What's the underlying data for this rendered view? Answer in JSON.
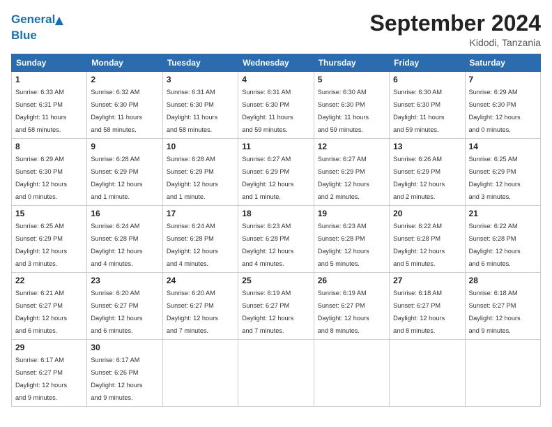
{
  "header": {
    "logo_line1": "General",
    "logo_line2": "Blue",
    "month": "September 2024",
    "location": "Kidodi, Tanzania"
  },
  "weekdays": [
    "Sunday",
    "Monday",
    "Tuesday",
    "Wednesday",
    "Thursday",
    "Friday",
    "Saturday"
  ],
  "days": [
    {
      "num": "1",
      "rise": "6:33 AM",
      "set": "6:31 PM",
      "hours": "11 hours",
      "mins": "58 minutes"
    },
    {
      "num": "2",
      "rise": "6:32 AM",
      "set": "6:30 PM",
      "hours": "11 hours",
      "mins": "58 minutes"
    },
    {
      "num": "3",
      "rise": "6:31 AM",
      "set": "6:30 PM",
      "hours": "11 hours",
      "mins": "58 minutes"
    },
    {
      "num": "4",
      "rise": "6:31 AM",
      "set": "6:30 PM",
      "hours": "11 hours",
      "mins": "59 minutes"
    },
    {
      "num": "5",
      "rise": "6:30 AM",
      "set": "6:30 PM",
      "hours": "11 hours",
      "mins": "59 minutes"
    },
    {
      "num": "6",
      "rise": "6:30 AM",
      "set": "6:30 PM",
      "hours": "11 hours",
      "mins": "59 minutes"
    },
    {
      "num": "7",
      "rise": "6:29 AM",
      "set": "6:30 PM",
      "hours": "12 hours",
      "mins": "0 minutes"
    },
    {
      "num": "8",
      "rise": "6:29 AM",
      "set": "6:30 PM",
      "hours": "12 hours",
      "mins": "0 minutes"
    },
    {
      "num": "9",
      "rise": "6:28 AM",
      "set": "6:29 PM",
      "hours": "12 hours",
      "mins": "1 minute"
    },
    {
      "num": "10",
      "rise": "6:28 AM",
      "set": "6:29 PM",
      "hours": "12 hours",
      "mins": "1 minute"
    },
    {
      "num": "11",
      "rise": "6:27 AM",
      "set": "6:29 PM",
      "hours": "12 hours",
      "mins": "1 minute"
    },
    {
      "num": "12",
      "rise": "6:27 AM",
      "set": "6:29 PM",
      "hours": "12 hours",
      "mins": "2 minutes"
    },
    {
      "num": "13",
      "rise": "6:26 AM",
      "set": "6:29 PM",
      "hours": "12 hours",
      "mins": "2 minutes"
    },
    {
      "num": "14",
      "rise": "6:25 AM",
      "set": "6:29 PM",
      "hours": "12 hours",
      "mins": "3 minutes"
    },
    {
      "num": "15",
      "rise": "6:25 AM",
      "set": "6:29 PM",
      "hours": "12 hours",
      "mins": "3 minutes"
    },
    {
      "num": "16",
      "rise": "6:24 AM",
      "set": "6:28 PM",
      "hours": "12 hours",
      "mins": "4 minutes"
    },
    {
      "num": "17",
      "rise": "6:24 AM",
      "set": "6:28 PM",
      "hours": "12 hours",
      "mins": "4 minutes"
    },
    {
      "num": "18",
      "rise": "6:23 AM",
      "set": "6:28 PM",
      "hours": "12 hours",
      "mins": "4 minutes"
    },
    {
      "num": "19",
      "rise": "6:23 AM",
      "set": "6:28 PM",
      "hours": "12 hours",
      "mins": "5 minutes"
    },
    {
      "num": "20",
      "rise": "6:22 AM",
      "set": "6:28 PM",
      "hours": "12 hours",
      "mins": "5 minutes"
    },
    {
      "num": "21",
      "rise": "6:22 AM",
      "set": "6:28 PM",
      "hours": "12 hours",
      "mins": "6 minutes"
    },
    {
      "num": "22",
      "rise": "6:21 AM",
      "set": "6:27 PM",
      "hours": "12 hours",
      "mins": "6 minutes"
    },
    {
      "num": "23",
      "rise": "6:20 AM",
      "set": "6:27 PM",
      "hours": "12 hours",
      "mins": "6 minutes"
    },
    {
      "num": "24",
      "rise": "6:20 AM",
      "set": "6:27 PM",
      "hours": "12 hours",
      "mins": "7 minutes"
    },
    {
      "num": "25",
      "rise": "6:19 AM",
      "set": "6:27 PM",
      "hours": "12 hours",
      "mins": "7 minutes"
    },
    {
      "num": "26",
      "rise": "6:19 AM",
      "set": "6:27 PM",
      "hours": "12 hours",
      "mins": "8 minutes"
    },
    {
      "num": "27",
      "rise": "6:18 AM",
      "set": "6:27 PM",
      "hours": "12 hours",
      "mins": "8 minutes"
    },
    {
      "num": "28",
      "rise": "6:18 AM",
      "set": "6:27 PM",
      "hours": "12 hours",
      "mins": "9 minutes"
    },
    {
      "num": "29",
      "rise": "6:17 AM",
      "set": "6:27 PM",
      "hours": "12 hours",
      "mins": "9 minutes"
    },
    {
      "num": "30",
      "rise": "6:17 AM",
      "set": "6:26 PM",
      "hours": "12 hours",
      "mins": "9 minutes"
    }
  ]
}
